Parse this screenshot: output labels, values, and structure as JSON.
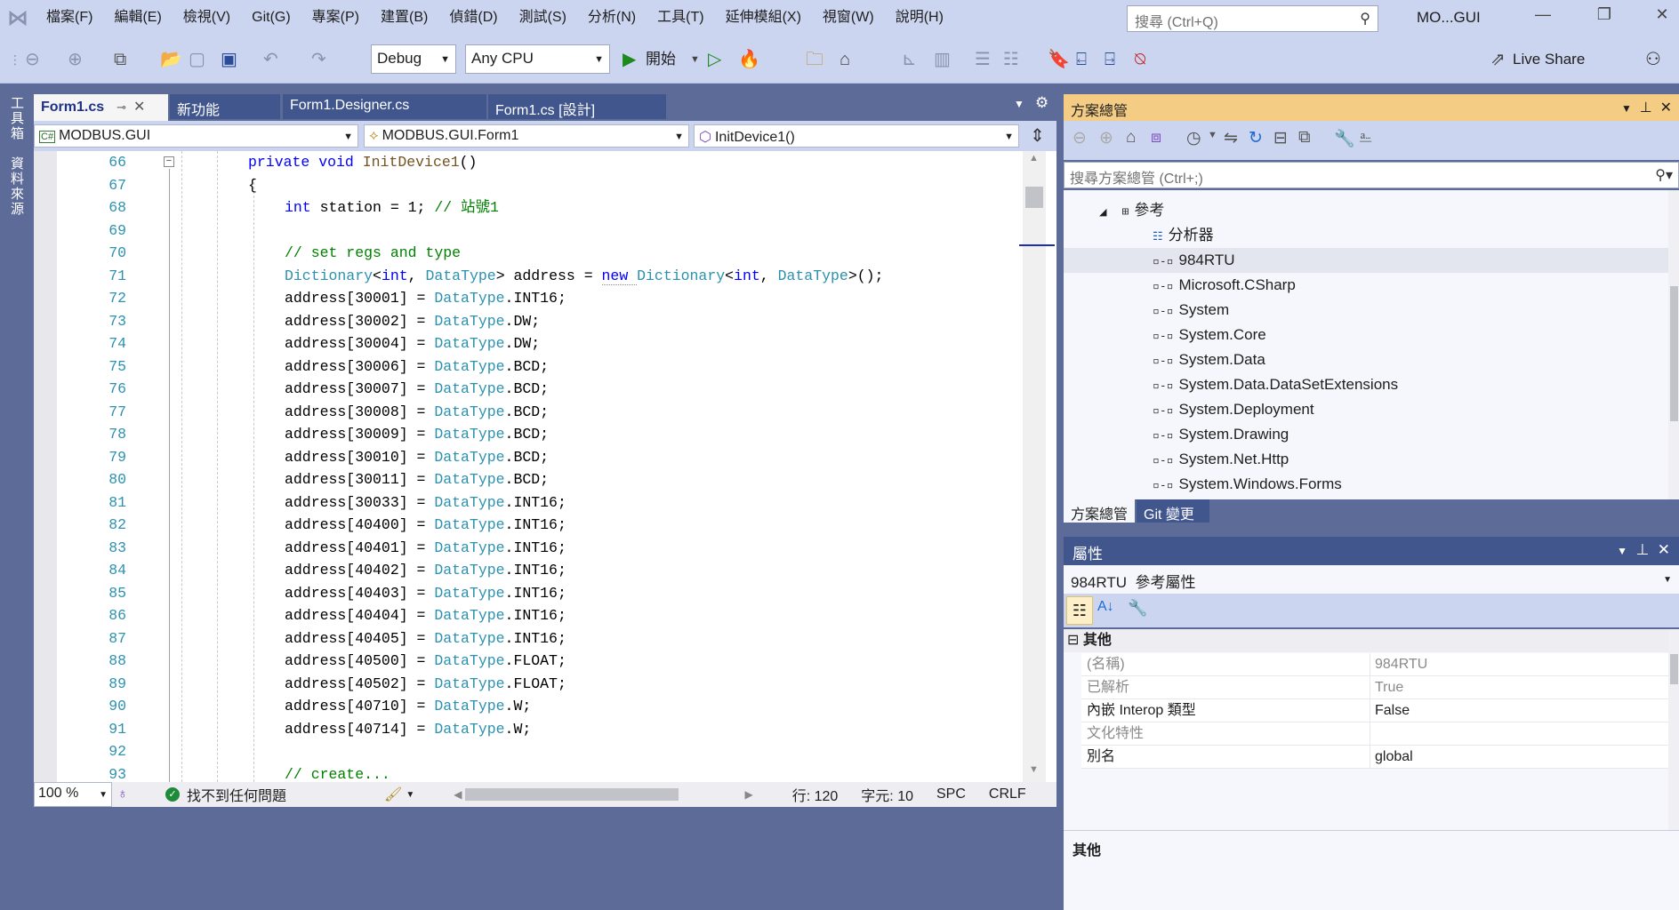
{
  "menu": [
    "檔案(F)",
    "編輯(E)",
    "檢視(V)",
    "Git(G)",
    "專案(P)",
    "建置(B)",
    "偵錯(D)",
    "測試(S)",
    "分析(N)",
    "工具(T)",
    "延伸模組(X)",
    "視窗(W)",
    "說明(H)"
  ],
  "search": {
    "placeholder": "搜尋 (Ctrl+Q)"
  },
  "window": {
    "title": "MO...GUI"
  },
  "toolbar": {
    "config": "Debug",
    "platform": "Any CPU",
    "start_label": "開始",
    "live_share": "Live Share"
  },
  "left_tabs": [
    "工具箱",
    "資料來源"
  ],
  "doc_tabs": [
    {
      "label": "Form1.cs",
      "active": true
    },
    {
      "label": "新功能"
    },
    {
      "label": "Form1.Designer.cs"
    },
    {
      "label": "Form1.cs [設計]"
    }
  ],
  "navbar": {
    "project": "MODBUS.GUI",
    "class": "MODBUS.GUI.Form1",
    "member": "InitDevice1()"
  },
  "code": [
    {
      "n": "66",
      "indent": 2,
      "tokens": [
        [
          "private ",
          "kw"
        ],
        [
          "void ",
          "kw"
        ],
        [
          "InitDevice1",
          "fn"
        ],
        [
          "()",
          "plain"
        ]
      ]
    },
    {
      "n": "67",
      "indent": 2,
      "tokens": [
        [
          "{",
          "plain"
        ]
      ]
    },
    {
      "n": "68",
      "indent": 3,
      "tokens": [
        [
          "int ",
          "kw"
        ],
        [
          "station = 1; ",
          "plain"
        ],
        [
          "// 站號1",
          "cm"
        ]
      ]
    },
    {
      "n": "69",
      "indent": 3,
      "tokens": []
    },
    {
      "n": "70",
      "indent": 3,
      "tokens": [
        [
          "// set regs and type",
          "cm"
        ]
      ]
    },
    {
      "n": "71",
      "indent": 3,
      "tokens": [
        [
          "Dictionary",
          "type"
        ],
        [
          "<",
          "plain"
        ],
        [
          "int",
          "kw"
        ],
        [
          ", ",
          "plain"
        ],
        [
          "DataType",
          "type"
        ],
        [
          "> address = ",
          "plain"
        ],
        [
          "new ",
          "kw"
        ],
        [
          "Dictionary",
          "type"
        ],
        [
          "<",
          "plain"
        ],
        [
          "int",
          "kw"
        ],
        [
          ", ",
          "plain"
        ],
        [
          "DataType",
          "type"
        ],
        [
          ">();",
          "plain"
        ]
      ]
    },
    {
      "n": "72",
      "indent": 3,
      "tokens": [
        [
          "address[30001] = ",
          "plain"
        ],
        [
          "DataType",
          "type"
        ],
        [
          ".INT16;",
          "plain"
        ]
      ]
    },
    {
      "n": "73",
      "indent": 3,
      "tokens": [
        [
          "address[30002] = ",
          "plain"
        ],
        [
          "DataType",
          "type"
        ],
        [
          ".DW;",
          "plain"
        ]
      ]
    },
    {
      "n": "74",
      "indent": 3,
      "tokens": [
        [
          "address[30004] = ",
          "plain"
        ],
        [
          "DataType",
          "type"
        ],
        [
          ".DW;",
          "plain"
        ]
      ]
    },
    {
      "n": "75",
      "indent": 3,
      "tokens": [
        [
          "address[30006] = ",
          "plain"
        ],
        [
          "DataType",
          "type"
        ],
        [
          ".BCD;",
          "plain"
        ]
      ]
    },
    {
      "n": "76",
      "indent": 3,
      "tokens": [
        [
          "address[30007] = ",
          "plain"
        ],
        [
          "DataType",
          "type"
        ],
        [
          ".BCD;",
          "plain"
        ]
      ]
    },
    {
      "n": "77",
      "indent": 3,
      "tokens": [
        [
          "address[30008] = ",
          "plain"
        ],
        [
          "DataType",
          "type"
        ],
        [
          ".BCD;",
          "plain"
        ]
      ]
    },
    {
      "n": "78",
      "indent": 3,
      "tokens": [
        [
          "address[30009] = ",
          "plain"
        ],
        [
          "DataType",
          "type"
        ],
        [
          ".BCD;",
          "plain"
        ]
      ]
    },
    {
      "n": "79",
      "indent": 3,
      "tokens": [
        [
          "address[30010] = ",
          "plain"
        ],
        [
          "DataType",
          "type"
        ],
        [
          ".BCD;",
          "plain"
        ]
      ]
    },
    {
      "n": "80",
      "indent": 3,
      "tokens": [
        [
          "address[30011] = ",
          "plain"
        ],
        [
          "DataType",
          "type"
        ],
        [
          ".BCD;",
          "plain"
        ]
      ]
    },
    {
      "n": "81",
      "indent": 3,
      "tokens": [
        [
          "address[30033] = ",
          "plain"
        ],
        [
          "DataType",
          "type"
        ],
        [
          ".INT16;",
          "plain"
        ]
      ]
    },
    {
      "n": "82",
      "indent": 3,
      "tokens": [
        [
          "address[40400] = ",
          "plain"
        ],
        [
          "DataType",
          "type"
        ],
        [
          ".INT16;",
          "plain"
        ]
      ]
    },
    {
      "n": "83",
      "indent": 3,
      "tokens": [
        [
          "address[40401] = ",
          "plain"
        ],
        [
          "DataType",
          "type"
        ],
        [
          ".INT16;",
          "plain"
        ]
      ]
    },
    {
      "n": "84",
      "indent": 3,
      "tokens": [
        [
          "address[40402] = ",
          "plain"
        ],
        [
          "DataType",
          "type"
        ],
        [
          ".INT16;",
          "plain"
        ]
      ]
    },
    {
      "n": "85",
      "indent": 3,
      "tokens": [
        [
          "address[40403] = ",
          "plain"
        ],
        [
          "DataType",
          "type"
        ],
        [
          ".INT16;",
          "plain"
        ]
      ]
    },
    {
      "n": "86",
      "indent": 3,
      "tokens": [
        [
          "address[40404] = ",
          "plain"
        ],
        [
          "DataType",
          "type"
        ],
        [
          ".INT16;",
          "plain"
        ]
      ]
    },
    {
      "n": "87",
      "indent": 3,
      "tokens": [
        [
          "address[40405] = ",
          "plain"
        ],
        [
          "DataType",
          "type"
        ],
        [
          ".INT16;",
          "plain"
        ]
      ]
    },
    {
      "n": "88",
      "indent": 3,
      "tokens": [
        [
          "address[40500] = ",
          "plain"
        ],
        [
          "DataType",
          "type"
        ],
        [
          ".FLOAT;",
          "plain"
        ]
      ]
    },
    {
      "n": "89",
      "indent": 3,
      "tokens": [
        [
          "address[40502] = ",
          "plain"
        ],
        [
          "DataType",
          "type"
        ],
        [
          ".FLOAT;",
          "plain"
        ]
      ]
    },
    {
      "n": "90",
      "indent": 3,
      "tokens": [
        [
          "address[40710] = ",
          "plain"
        ],
        [
          "DataType",
          "type"
        ],
        [
          ".W;",
          "plain"
        ]
      ]
    },
    {
      "n": "91",
      "indent": 3,
      "tokens": [
        [
          "address[40714] = ",
          "plain"
        ],
        [
          "DataType",
          "type"
        ],
        [
          ".W;",
          "plain"
        ]
      ]
    },
    {
      "n": "92",
      "indent": 3,
      "tokens": []
    },
    {
      "n": "93",
      "indent": 3,
      "tokens": [
        [
          "// create...",
          "cm"
        ]
      ]
    }
  ],
  "statusbar": {
    "zoom": "100 %",
    "issues": "找不到任何問題",
    "line": "行: 120",
    "col": "字元: 10",
    "spc": "SPC",
    "eol": "CRLF"
  },
  "solution_explorer": {
    "title": "方案總管",
    "search_placeholder": "搜尋方案總管 (Ctrl+;)",
    "tree": [
      {
        "label": "參考",
        "level": 0,
        "icon": "references-icon",
        "expanded": true
      },
      {
        "label": "分析器",
        "level": 1,
        "icon": "analyzer-icon"
      },
      {
        "label": "984RTU",
        "level": 1,
        "icon": "reference-icon",
        "selected": true
      },
      {
        "label": "Microsoft.CSharp",
        "level": 1,
        "icon": "reference-icon"
      },
      {
        "label": "System",
        "level": 1,
        "icon": "reference-icon"
      },
      {
        "label": "System.Core",
        "level": 1,
        "icon": "reference-icon"
      },
      {
        "label": "System.Data",
        "level": 1,
        "icon": "reference-icon"
      },
      {
        "label": "System.Data.DataSetExtensions",
        "level": 1,
        "icon": "reference-icon"
      },
      {
        "label": "System.Deployment",
        "level": 1,
        "icon": "reference-icon"
      },
      {
        "label": "System.Drawing",
        "level": 1,
        "icon": "reference-icon"
      },
      {
        "label": "System.Net.Http",
        "level": 1,
        "icon": "reference-icon"
      },
      {
        "label": "System.Windows.Forms",
        "level": 1,
        "icon": "reference-icon"
      }
    ],
    "tabs": [
      "方案總管",
      "Git 變更"
    ]
  },
  "properties": {
    "title": "屬性",
    "object_name": "984RTU",
    "object_type": "參考屬性",
    "category": "其他",
    "rows": [
      {
        "name": "(名稱)",
        "value": "984RTU",
        "readonly": true
      },
      {
        "name": "已解析",
        "value": "True",
        "readonly": true
      },
      {
        "name": "內嵌 Interop 類型",
        "value": "False"
      },
      {
        "name": "文化特性",
        "value": "",
        "readonly": true
      },
      {
        "name": "別名",
        "value": "global"
      }
    ],
    "description": "其他"
  },
  "colors": {
    "frame": "#5d6b99",
    "menubar": "#ccd5f0",
    "active_panel_header": "#f5cc84",
    "keyword": "#0000ff",
    "type": "#2b91af",
    "comment": "#008000"
  }
}
